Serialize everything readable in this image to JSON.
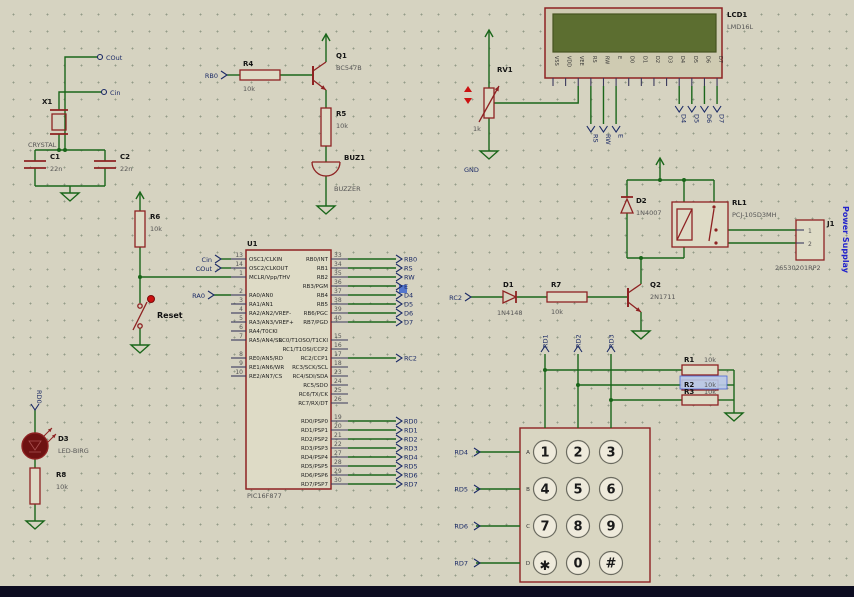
{
  "oscillator": {
    "cout_label": "COut",
    "cin_label": "Cin",
    "x1_ref": "X1",
    "x1_value": "CRYSTAL",
    "c1_ref": "C1",
    "c1_value": "22n",
    "c2_ref": "C2",
    "c2_value": "22n"
  },
  "buzzer_circuit": {
    "rb0_label": "RB0",
    "r4_ref": "R4",
    "r4_value": "10k",
    "q1_ref": "Q1",
    "q1_value": "BC547B",
    "r5_ref": "R5",
    "r5_value": "10k",
    "buz_ref": "BUZ1",
    "buz_value": "BUZZER"
  },
  "reset_circuit": {
    "r6_ref": "R6",
    "r6_value": "10k",
    "button_label": "Reset",
    "ra0_label": "RA0",
    "cin_label": "Cin",
    "cout_label": "COut"
  },
  "mcu": {
    "ref": "U1",
    "value": "PIC16F877",
    "left_pins": [
      {
        "num": "13",
        "name": "OSC1/CLKIN"
      },
      {
        "num": "14",
        "name": "OSC2/CLKOUT"
      },
      {
        "num": "1",
        "name": "MCLR/Vpp/THV"
      },
      {
        "num": "2",
        "name": "RA0/AN0"
      },
      {
        "num": "3",
        "name": "RA1/AN1"
      },
      {
        "num": "4",
        "name": "RA2/AN2/VREF-"
      },
      {
        "num": "5",
        "name": "RA3/AN3/VREF+"
      },
      {
        "num": "6",
        "name": "RA4/T0CKI"
      },
      {
        "num": "7",
        "name": "RA5/AN4/SS"
      },
      {
        "num": "8",
        "name": "RE0/AN5/RD"
      },
      {
        "num": "9",
        "name": "RE1/AN6/WR"
      },
      {
        "num": "10",
        "name": "RE2/AN7/CS"
      }
    ],
    "rb_pins": [
      {
        "num": "33",
        "name": "RB0/INT",
        "net": "RB0"
      },
      {
        "num": "34",
        "name": "RB1",
        "net": "RS"
      },
      {
        "num": "35",
        "name": "RB2",
        "net": "RW"
      },
      {
        "num": "36",
        "name": "RB3/PGM",
        "net": "E"
      },
      {
        "num": "37",
        "name": "RB4",
        "net": "D4"
      },
      {
        "num": "38",
        "name": "RB5",
        "net": "D5"
      },
      {
        "num": "39",
        "name": "RB6/PGC",
        "net": "D6"
      },
      {
        "num": "40",
        "name": "RB7/PGD",
        "net": "D7"
      }
    ],
    "rc_pins": [
      {
        "num": "15",
        "name": "RC0/T1OSO/T1CKI",
        "net": ""
      },
      {
        "num": "16",
        "name": "RC1/T1OSI/CCP2",
        "net": ""
      },
      {
        "num": "17",
        "name": "RC2/CCP1",
        "net": "RC2"
      },
      {
        "num": "18",
        "name": "RC3/SCK/SCL",
        "net": ""
      },
      {
        "num": "23",
        "name": "RC4/SDI/SDA",
        "net": ""
      },
      {
        "num": "24",
        "name": "RC5/SDO",
        "net": ""
      },
      {
        "num": "25",
        "name": "RC6/TX/CK",
        "net": ""
      },
      {
        "num": "26",
        "name": "RC7/RX/DT",
        "net": ""
      }
    ],
    "rd_pins": [
      {
        "num": "19",
        "name": "RD0/PSP0",
        "net": "RD0"
      },
      {
        "num": "20",
        "name": "RD1/PSP1",
        "net": "RD1"
      },
      {
        "num": "21",
        "name": "RD2/PSP2",
        "net": "RD2"
      },
      {
        "num": "22",
        "name": "RD3/PSP3",
        "net": "RD3"
      },
      {
        "num": "27",
        "name": "RD4/PSP4",
        "net": "RD4"
      },
      {
        "num": "28",
        "name": "RD5/PSP5",
        "net": "RD5"
      },
      {
        "num": "29",
        "name": "RD6/PSP6",
        "net": "RD6"
      },
      {
        "num": "30",
        "name": "RD7/PSP7",
        "net": "RD7"
      }
    ]
  },
  "lcd": {
    "ref": "LCD1",
    "value": "LMD16L",
    "pins": [
      "VSS",
      "VDD",
      "VEE",
      "RS",
      "RW",
      "E",
      "D0",
      "D1",
      "D2",
      "D3",
      "D4",
      "D5",
      "D6",
      "D7"
    ],
    "ctrl_nets": [
      "RS",
      "RW",
      "E"
    ],
    "data_nets": [
      "D4",
      "D5",
      "D6",
      "D7"
    ]
  },
  "pot": {
    "ref": "RV1",
    "value": "1k",
    "gnd_label": "GND"
  },
  "relay_circuit": {
    "d2_ref": "D2",
    "d2_value": "1N4007",
    "rl1_ref": "RL1",
    "rl1_value": "PCJ-105D3MH",
    "j1_ref": "J1",
    "j1_value": "26530201RP2",
    "j1_pin1": "1",
    "j1_pin2": "2",
    "note": "Power Supplay"
  },
  "driver_circuit": {
    "rc2_label": "RC2",
    "d1_ref": "D1",
    "d1_value": "1N4148",
    "r7_ref": "R7",
    "r7_value": "10k",
    "q2_ref": "Q2",
    "q2_value": "2N1711"
  },
  "pulldowns": {
    "r1_ref": "R1",
    "r1_value": "10k",
    "r2_ref": "R2",
    "r2_value": "10k",
    "r3_ref": "R3",
    "r3_value": "10k"
  },
  "keypad": {
    "row_labels": [
      "A",
      "B",
      "C",
      "D"
    ],
    "keys": [
      [
        "1",
        "2",
        "3"
      ],
      [
        "4",
        "5",
        "6"
      ],
      [
        "7",
        "8",
        "9"
      ],
      [
        "✱",
        "0",
        "#"
      ]
    ],
    "row_nets": [
      "RD4",
      "RD5",
      "RD6",
      "RD7"
    ],
    "col_nets": [
      "RD1",
      "RD2",
      "RD3"
    ]
  },
  "led_circuit": {
    "net": "RD0",
    "d3_ref": "D3",
    "d3_value": "LED-BIRG",
    "r8_ref": "R8",
    "r8_value": "10k"
  }
}
